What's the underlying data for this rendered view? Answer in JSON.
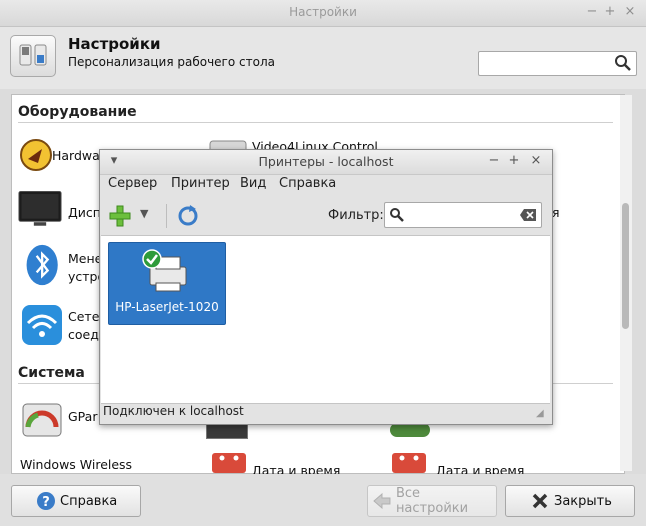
{
  "window": {
    "title": "Настройки",
    "buttons": {
      "minimize": "−",
      "maximize": "+",
      "close": "×"
    }
  },
  "header": {
    "title": "Настройки",
    "subtitle": "Персонализация рабочего стола",
    "search_placeholder": ""
  },
  "sections": {
    "hardware": {
      "title": "Оборудование",
      "items": [
        {
          "label": "Hardwa",
          "icon": "hardware-locator-icon"
        },
        {
          "label": "Video4Linux Control",
          "icon": "webcam-icon"
        },
        {
          "label": "Дисп",
          "icon": "display-monitor-icon"
        },
        {
          "label": "я",
          "icon": "hidden-item-icon"
        },
        {
          "label": "Мене",
          "label2": "устро",
          "icon": "bluetooth-icon"
        },
        {
          "label": "Сетев",
          "label2": "соеди",
          "icon": "wifi-icon"
        }
      ]
    },
    "system": {
      "title": "Система",
      "items": [
        {
          "label": "GPar",
          "icon": "gparted-icon"
        },
        {
          "label": "Windows Wireless",
          "icon": ""
        },
        {
          "label": "Дата и время",
          "icon": "calendar-icon"
        },
        {
          "label": "Дата и время",
          "icon": "calendar-icon"
        }
      ]
    }
  },
  "bottom_bar": {
    "help": "Справка",
    "all_settings": "Все настройки",
    "close": "Закрыть"
  },
  "printer_window": {
    "title": "Принтеры - localhost",
    "menu": [
      "Сервер",
      "Принтер",
      "Вид",
      "Справка"
    ],
    "filter_label": "Фильтр:",
    "filter_value": "",
    "printers": [
      {
        "name": "HP-LaserJet-1020",
        "status": "default"
      }
    ],
    "status": "Подключен к localhost"
  },
  "colors": {
    "accent": "#2f78c6",
    "content_bg": "#ffffff",
    "window_bg": "#dcdcdc"
  }
}
